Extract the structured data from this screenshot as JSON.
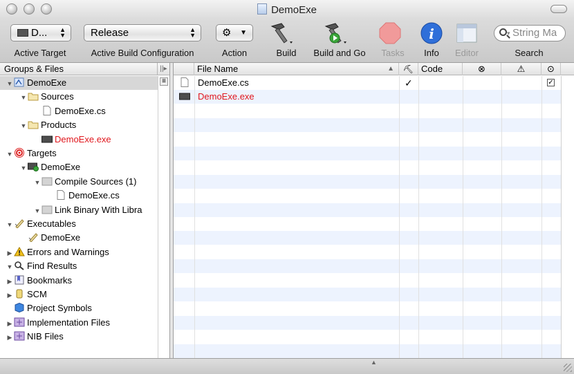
{
  "window": {
    "title": "DemoExe"
  },
  "toolbar": {
    "target_popup": "D...",
    "config_popup": "Release",
    "labels": {
      "active_target": "Active Target",
      "active_config": "Active Build Configuration",
      "action": "Action",
      "build": "Build",
      "build_and_go": "Build and Go",
      "tasks": "Tasks",
      "info": "Info",
      "editor": "Editor",
      "search": "Search"
    },
    "search_placeholder": "String Ma"
  },
  "sidebar": {
    "header": "Groups & Files",
    "items": [
      {
        "label": "DemoExe",
        "icon": "project-icon",
        "level": 0,
        "disclosure": "open",
        "selected": true
      },
      {
        "label": "Sources",
        "icon": "folder-icon",
        "level": 1,
        "disclosure": "open"
      },
      {
        "label": "DemoExe.cs",
        "icon": "file-icon",
        "level": 2,
        "disclosure": "none"
      },
      {
        "label": "Products",
        "icon": "folder-icon",
        "level": 1,
        "disclosure": "open"
      },
      {
        "label": "DemoExe.exe",
        "icon": "executable-icon",
        "level": 2,
        "disclosure": "none",
        "missing": true
      },
      {
        "label": "Targets",
        "icon": "target-icon",
        "level": 0,
        "disclosure": "open"
      },
      {
        "label": "DemoExe",
        "icon": "target-app-icon",
        "level": 1,
        "disclosure": "open"
      },
      {
        "label": "Compile Sources (1)",
        "icon": "build-phase-icon",
        "level": 2,
        "disclosure": "open"
      },
      {
        "label": "DemoExe.cs",
        "icon": "file-icon",
        "level": 3,
        "disclosure": "none"
      },
      {
        "label": "Link Binary With Libra",
        "icon": "build-phase-icon",
        "level": 2,
        "disclosure": "open"
      },
      {
        "label": "Executables",
        "icon": "executables-icon",
        "level": 0,
        "disclosure": "open"
      },
      {
        "label": "DemoExe",
        "icon": "executables-icon",
        "level": 1,
        "disclosure": "none"
      },
      {
        "label": "Errors and Warnings",
        "icon": "warning-icon",
        "level": 0,
        "disclosure": "closed"
      },
      {
        "label": "Find Results",
        "icon": "search-icon",
        "level": 0,
        "disclosure": "open"
      },
      {
        "label": "Bookmarks",
        "icon": "bookmarks-icon",
        "level": 0,
        "disclosure": "closed"
      },
      {
        "label": "SCM",
        "icon": "scm-icon",
        "level": 0,
        "disclosure": "closed"
      },
      {
        "label": "Project Symbols",
        "icon": "symbols-icon",
        "level": 0,
        "disclosure": "none"
      },
      {
        "label": "Implementation Files",
        "icon": "smart-group-icon",
        "level": 0,
        "disclosure": "closed"
      },
      {
        "label": "NIB Files",
        "icon": "smart-group-icon",
        "level": 0,
        "disclosure": "closed"
      }
    ]
  },
  "detail": {
    "columns": {
      "file_name": "File Name",
      "code": "Code"
    },
    "column_icons": [
      "build-hammer-icon",
      "errors-icon",
      "warnings-icon",
      "target-membership-icon"
    ],
    "rows": [
      {
        "name": "DemoExe.cs",
        "icon": "file-icon",
        "build": "✓",
        "target_checked": true,
        "missing": false
      },
      {
        "name": "DemoExe.exe",
        "icon": "executable-icon",
        "build": "",
        "target_checked": false,
        "missing": true
      }
    ],
    "colors": {
      "stripe": "#edf3fe",
      "missing_text": "#e0161c",
      "selection": "#d7d7d7"
    }
  }
}
